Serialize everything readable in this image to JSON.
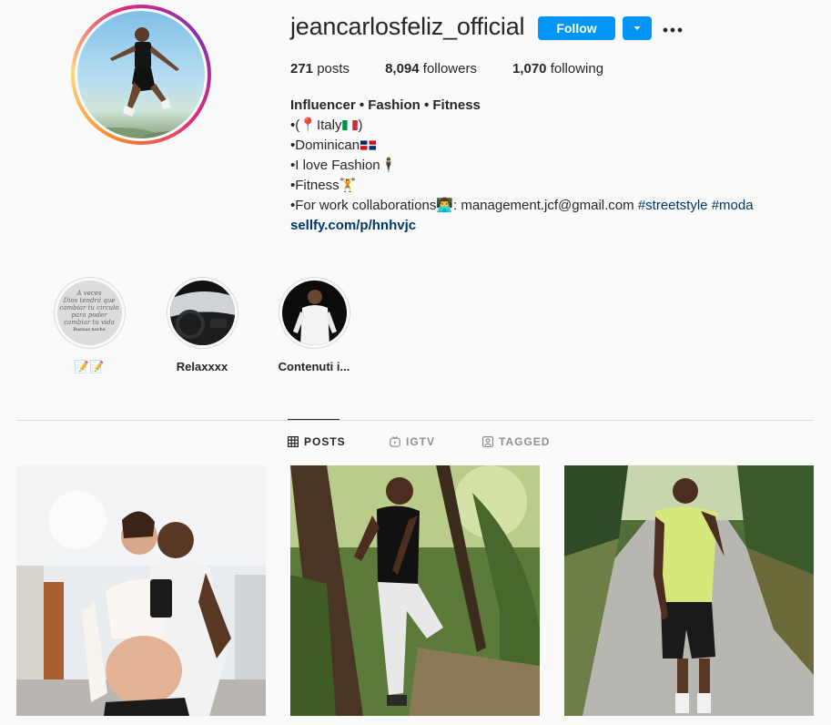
{
  "profile": {
    "username": "jeancarlosfeliz_official",
    "follow_label": "Follow",
    "avatar_icon": "profile-avatar",
    "more_icon": "more-options-icon",
    "dropdown_icon": "chevron-down-icon",
    "stats": {
      "posts_count": "271",
      "posts_label": "posts",
      "followers_count": "8,094",
      "followers_label": "followers",
      "following_count": "1,070",
      "following_label": "following"
    },
    "bio": {
      "fullname": "Influencer • Fashion • Fitness",
      "line1_prefix": "•(",
      "line1_text": "Italy",
      "line1_suffix": ")",
      "line2": "•Dominican",
      "line3": "•I love Fashion",
      "line4": "•Fitness",
      "line5_prefix": "•For work collaborations",
      "line5_text": ": management.jcf@gmail.com",
      "hashtag1": "#streetstyle",
      "hashtag2": "#moda",
      "link": "sellfy.com/p/hnhvjc"
    }
  },
  "highlights": [
    {
      "label": "📝📝",
      "image_text": [
        "A veces",
        "Dios tendrá que",
        "cambiar tu circulo",
        "para poder",
        "cambiar tu vida",
        "Buenas noche"
      ]
    },
    {
      "label": "Relaxxxx"
    },
    {
      "label": "Contenuti i..."
    }
  ],
  "tabs": {
    "posts": "POSTS",
    "igtv": "IGTV",
    "tagged": "TAGGED"
  },
  "colors": {
    "accent": "#0095f6",
    "text": "#262626",
    "muted": "#8e8e8e",
    "link": "#00376b",
    "background": "#fafafa",
    "border": "#dbdbdb"
  }
}
